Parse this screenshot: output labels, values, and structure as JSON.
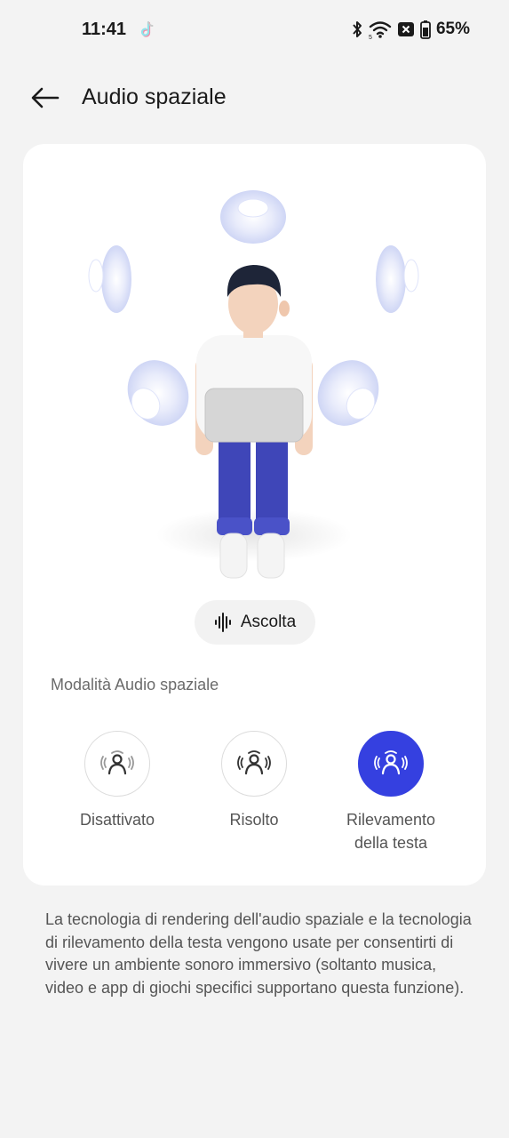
{
  "status_bar": {
    "time": "11:41",
    "battery_percent": "65%",
    "icons": [
      "tiktok-icon",
      "bluetooth-icon",
      "wifi-icon",
      "sim-disabled-icon",
      "battery-icon"
    ]
  },
  "header": {
    "back_icon": "arrow-left-icon",
    "title": "Audio spaziale"
  },
  "card": {
    "listen_button": {
      "label": "Ascolta",
      "icon": "waveform-icon"
    },
    "section_label": "Modalità Audio spaziale",
    "modes": [
      {
        "label": "Disattivato",
        "icon": "person-sound-icon",
        "selected": false
      },
      {
        "label": "Risolto",
        "icon": "person-sound-icon",
        "selected": false
      },
      {
        "label_line1": "Rilevamento",
        "label_line2": "della testa",
        "icon": "head-tracking-icon",
        "selected": true
      }
    ]
  },
  "description": "La tecnologia di rendering dell'audio spaziale e la tecnologia di rilevamento della testa vengono usate per consentirti di vivere un ambiente sonoro immersivo (soltanto musica, video e app di giochi specifici supportano questa funzione).",
  "colors": {
    "background": "#f3f3f3",
    "card": "#ffffff",
    "accent": "#3540e0",
    "text_primary": "#1a1a1a",
    "text_secondary": "#555555"
  }
}
